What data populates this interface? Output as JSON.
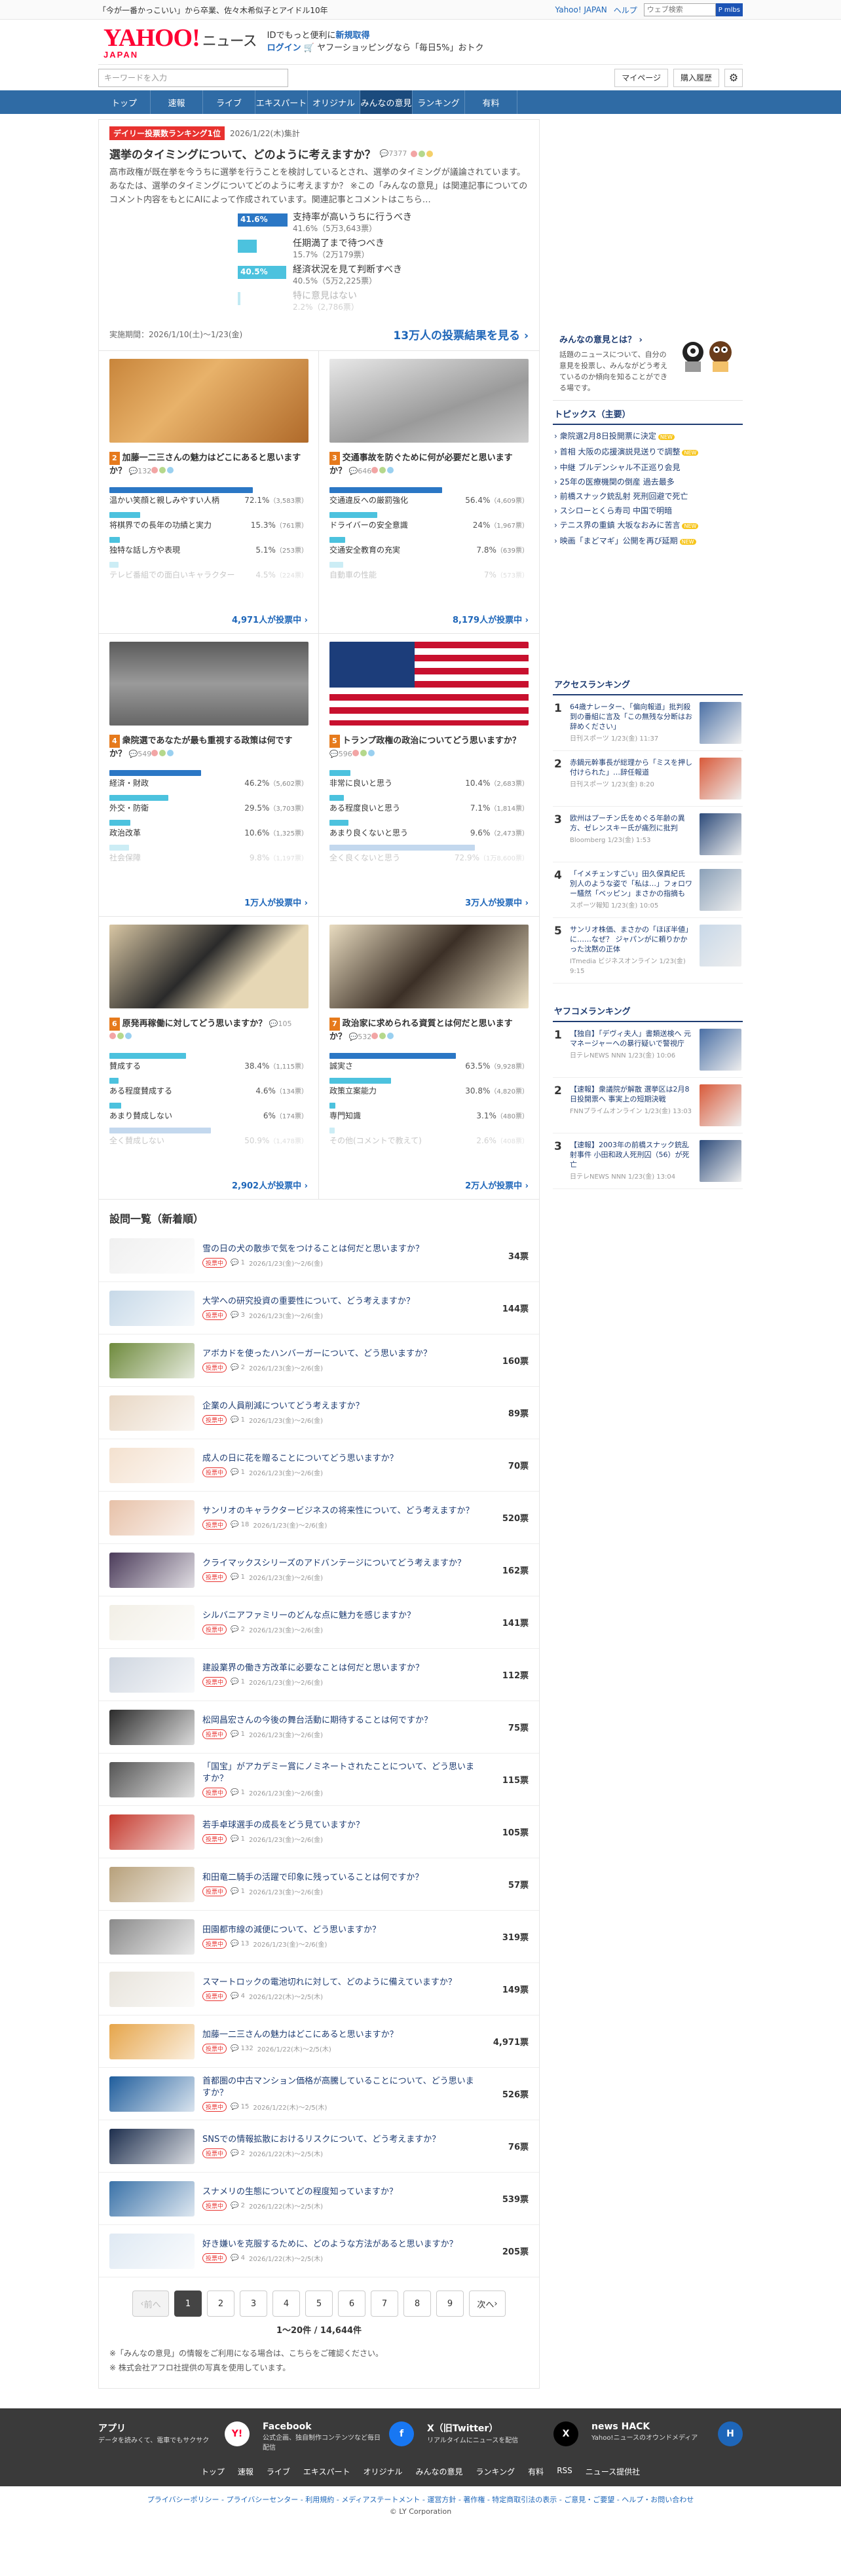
{
  "topbar": {
    "promo": "「今が一番かっこいい」から卒業、佐々木希似子とアイドル10年",
    "links": [
      "Yahoo! JAPAN",
      "ヘルプ"
    ],
    "search_placeholder": "ウェブ検索",
    "search_btn": "P mlbs"
  },
  "header": {
    "logo": "YAHOO!",
    "logo_sub": "JAPAN",
    "logo_news": "ニュース",
    "line1": "IDでもっと便利に",
    "line1_link": "新規取得",
    "line2_login": "ログイン",
    "line2": "ヤフーショッピングなら「毎日5%」おトク"
  },
  "search": {
    "placeholder": "キーワードを入力",
    "mypage": "マイページ",
    "history": "購入履歴"
  },
  "nav": [
    "トップ",
    "速報",
    "ライブ",
    "エキスパート",
    "オリジナル",
    "みんなの意見",
    "ランキング",
    "有料"
  ],
  "featured": {
    "tag": "デイリー投票数ランキング1位",
    "date": "2026/1/22(木)集計",
    "title": "選挙のタイミングについて、どのように考えますか？",
    "comments": "7377",
    "desc": "高市政権が既在挙を今うちに選挙を行うことを検討しているとされ、選挙のタイミングが議論されています。あなたは、選挙のタイミングについてどのように考えますか？ ※この「みんなの意見」は関連記事についてのコメント内容をもとにAIによって作成されています。関連記事とコメントはこちら…",
    "options": [
      {
        "pct": "41.6%",
        "value": 41.6,
        "label": "支持率が高いうちに行うべき",
        "sub": "41.6%（5万3,643票）"
      },
      {
        "pct": "",
        "value": 15.7,
        "label": "任期満了まで待つべき",
        "sub": "15.7%（2万179票）"
      },
      {
        "pct": "40.5%",
        "value": 40.5,
        "label": "経済状況を見て判断すべき",
        "sub": "40.5%（5万2,225票）"
      },
      {
        "pct": "",
        "value": 2.2,
        "label": "特に意見はない",
        "sub": "2.2%（2,786票）"
      }
    ],
    "period": "実施期間：2026/1/10(土)〜1/23(金)",
    "cta": "13万人の投票結果を見る"
  },
  "cards": [
    {
      "num": "2",
      "title": "加藤一二三さんの魅力はどこにあると思いますか？",
      "cm": "132",
      "opts": [
        [
          "温かい笑顔と親しみやすい人柄",
          "72.1%",
          "（3,583票）",
          72.1
        ],
        [
          "将棋界での長年の功績と実力",
          "15.3%",
          "（761票）",
          15.3
        ],
        [
          "独特な話し方や表現",
          "5.1%",
          "（253票）",
          5.1
        ],
        [
          "テレビ番組での面白いキャラクター",
          "4.5%",
          "（224票）",
          4.5
        ]
      ],
      "foot": "4,971人が投票中"
    },
    {
      "num": "3",
      "title": "交通事故を防ぐために何が必要だと思いますか？",
      "cm": "646",
      "opts": [
        [
          "交通違反への厳罰強化",
          "56.4%",
          "（4,609票）",
          56.4
        ],
        [
          "ドライバーの安全意識",
          "24%",
          "（1,967票）",
          24
        ],
        [
          "交通安全教育の充実",
          "7.8%",
          "（639票）",
          7.8
        ],
        [
          "自動車の性能",
          "7%",
          "（573票）",
          7
        ]
      ],
      "foot": "8,179人が投票中"
    },
    {
      "num": "4",
      "title": "衆院選であなたが最も重視する政策は何ですか？",
      "cm": "549",
      "opts": [
        [
          "経済・財政",
          "46.2%",
          "（5,602票）",
          46.2
        ],
        [
          "外交・防衛",
          "29.5%",
          "（3,703票）",
          29.5
        ],
        [
          "政治改革",
          "10.6%",
          "（1,325票）",
          10.6
        ],
        [
          "社会保障",
          "9.8%",
          "（1,197票）",
          9.8
        ]
      ],
      "foot": "1万人が投票中"
    },
    {
      "num": "5",
      "title": "トランプ政権の政治についてどう思いますか？",
      "cm": "596",
      "opts": [
        [
          "非常に良いと思う",
          "10.4%",
          "（2,683票）",
          10.4
        ],
        [
          "ある程度良いと思う",
          "7.1%",
          "（1,814票）",
          7.1
        ],
        [
          "あまり良くないと思う",
          "9.6%",
          "（2,473票）",
          9.6
        ],
        [
          "全く良くないと思う",
          "72.9%",
          "（1万8,600票）",
          72.9
        ]
      ],
      "foot": "3万人が投票中"
    },
    {
      "num": "6",
      "title": "原発再稼働に対してどう思いますか？",
      "cm": "105",
      "opts": [
        [
          "賛成する",
          "38.4%",
          "（1,115票）",
          38.4
        ],
        [
          "ある程度賛成する",
          "4.6%",
          "（134票）",
          4.6
        ],
        [
          "あまり賛成しない",
          "6%",
          "（174票）",
          6
        ],
        [
          "全く賛成しない",
          "50.9%",
          "（1,478票）",
          50.9
        ]
      ],
      "foot": "2,902人が投票中"
    },
    {
      "num": "7",
      "title": "政治家に求められる資質とは何だと思いますか？",
      "cm": "532",
      "opts": [
        [
          "誠実さ",
          "63.5%",
          "（9,928票）",
          63.5
        ],
        [
          "政策立案能力",
          "30.8%",
          "（4,820票）",
          30.8
        ],
        [
          "専門知識",
          "3.1%",
          "（480票）",
          3.1
        ],
        [
          "その他(コメントで教えて)",
          "2.6%",
          "（408票）",
          2.6
        ]
      ],
      "foot": "2万人が投票中"
    }
  ],
  "list": {
    "heading": "設問一覧（新着順）",
    "badge": "投票中",
    "items": [
      {
        "t": "雪の日の犬の散歩で気をつけることは何だと思いますか？",
        "c": "1",
        "d": "2026/1/23(金)〜2/6(金)",
        "v": "34票"
      },
      {
        "t": "大学への研究投資の重要性について、どう考えますか？",
        "c": "3",
        "d": "2026/1/23(金)〜2/6(金)",
        "v": "144票"
      },
      {
        "t": "アボカドを使ったハンバーガーについて、どう思いますか？",
        "c": "2",
        "d": "2026/1/23(金)〜2/6(金)",
        "v": "160票"
      },
      {
        "t": "企業の人員削減についてどう考えますか？",
        "c": "1",
        "d": "2026/1/23(金)〜2/6(金)",
        "v": "89票"
      },
      {
        "t": "成人の日に花を贈ることについてどう思いますか？",
        "c": "1",
        "d": "2026/1/23(金)〜2/6(金)",
        "v": "70票"
      },
      {
        "t": "サンリオのキャラクタービジネスの将来性について、どう考えますか？",
        "c": "18",
        "d": "2026/1/23(金)〜2/6(金)",
        "v": "520票"
      },
      {
        "t": "クライマックスシリーズのアドバンテージについてどう考えますか？",
        "c": "1",
        "d": "2026/1/23(金)〜2/6(金)",
        "v": "162票"
      },
      {
        "t": "シルバニアファミリーのどんな点に魅力を感じますか？",
        "c": "2",
        "d": "2026/1/23(金)〜2/6(金)",
        "v": "141票"
      },
      {
        "t": "建設業界の働き方改革に必要なことは何だと思いますか？",
        "c": "1",
        "d": "2026/1/23(金)〜2/6(金)",
        "v": "112票"
      },
      {
        "t": "松岡昌宏さんの今後の舞台活動に期待することは何ですか？",
        "c": "1",
        "d": "2026/1/23(金)〜2/6(金)",
        "v": "75票"
      },
      {
        "t": "「国宝」がアカデミー賞にノミネートされたことについて、どう思いますか？",
        "c": "1",
        "d": "2026/1/23(金)〜2/6(金)",
        "v": "115票"
      },
      {
        "t": "若手卓球選手の成長をどう見ていますか？",
        "c": "1",
        "d": "2026/1/23(金)〜2/6(金)",
        "v": "105票"
      },
      {
        "t": "和田竜二騎手の活躍で印象に残っていることは何ですか？",
        "c": "1",
        "d": "2026/1/23(金)〜2/6(金)",
        "v": "57票"
      },
      {
        "t": "田園都市線の減便について、どう思いますか？",
        "c": "13",
        "d": "2026/1/23(金)〜2/6(金)",
        "v": "319票"
      },
      {
        "t": "スマートロックの電池切れに対して、どのように備えていますか？",
        "c": "4",
        "d": "2026/1/22(木)〜2/5(木)",
        "v": "149票"
      },
      {
        "t": "加藤一二三さんの魅力はどこにあると思いますか？",
        "c": "132",
        "d": "2026/1/22(木)〜2/5(木)",
        "v": "4,971票"
      },
      {
        "t": "首都圏の中古マンション価格が高騰していることについて、どう思いますか？",
        "c": "15",
        "d": "2026/1/22(木)〜2/5(木)",
        "v": "526票"
      },
      {
        "t": "SNSでの情報拡散におけるリスクについて、どう考えますか？",
        "c": "2",
        "d": "2026/1/22(木)〜2/5(木)",
        "v": "76票"
      },
      {
        "t": "スナメリの生態についてどの程度知っていますか？",
        "c": "2",
        "d": "2026/1/22(木)〜2/5(木)",
        "v": "539票"
      },
      {
        "t": "好き嫌いを克服するために、どのような方法があると思いますか？",
        "c": "4",
        "d": "2026/1/22(木)〜2/5(木)",
        "v": "205票"
      }
    ]
  },
  "pager": {
    "prev": "前へ",
    "pages": [
      "1",
      "2",
      "3",
      "4",
      "5",
      "6",
      "7",
      "8",
      "9"
    ],
    "next": "次へ",
    "count": "1〜20件 / 14,644件"
  },
  "notes": [
    "※「みんなの意見」の情報をご利用になる場合は、こちらをご確認ください。",
    "※ 株式会社アフロ社提供の写真を使用しています。"
  ],
  "right": {
    "op_title": "みんなの意見とは？",
    "op_desc": "話題のニュースについて、自分の意見を投票し、みんながどう考えているのか傾向を知ることができる場です。",
    "topics_h": "トピックス（主要）",
    "topics": [
      "衆院選2月8日投開票に決定",
      "首相 大阪の応援演説見送りで調整",
      "中継 ブルデンシャル不正巡り会見",
      "25年の医療機関の倒産 過去最多",
      "前橋スナック銃乱射 死刑回避で死亡",
      "スシローとくら寿司 中国で明暗",
      "テニス界の重鎮 大坂なおみに苦言",
      "映画「まどマギ」公開を再び延期"
    ],
    "access_h": "アクセスランキング",
    "access": [
      {
        "n": "1",
        "t": "64歳ナレーター、「偏向報道」批判殺到の番組に言及「この無残な分断はお辞めください」",
        "s": "日刊スポーツ 1/23(金) 11:37"
      },
      {
        "n": "2",
        "t": "赤鍋元幹事長が総理から「ミスを押し付けられた」…辞任報道",
        "s": "日刊スポーツ 1/23(金) 8:20"
      },
      {
        "n": "3",
        "t": "欧州はプーチン氏をめぐる年齢の異方、ゼレンスキー氏が痛烈に批判",
        "s": "Bloomberg 1/23(金) 1:53"
      },
      {
        "n": "4",
        "t": "「イメチェンすごい」田久保真紀氏 別人のような姿で「私は…」フォロワー騒然「ベッピン」まさかの指摘も",
        "s": "スポーツ報知 1/23(金) 10:05"
      },
      {
        "n": "5",
        "t": "サンリオ株価、まさかの「ほぼ半値」に……なぜ？ ジャパンがに頼りかかった沈黙の正体",
        "s": "ITmedia ビジネスオンライン 1/23(金) 9:15"
      }
    ],
    "yafuko_h": "ヤフコメランキング",
    "yafuko": [
      {
        "n": "1",
        "t": "【独自】「デヴィ夫人」書類送検へ 元マネージャーへの暴行疑いで警視庁",
        "s": "日テレNEWS NNN 1/23(金) 10:06"
      },
      {
        "n": "2",
        "t": "【速報】衆議院が解散 選挙区は2月8日投開票へ 事実上の短期決戦",
        "s": "FNNプライムオンライン 1/23(金) 13:03"
      },
      {
        "n": "3",
        "t": "【速報】2003年の前橋スナック銃乱射事件 小田和政人死刑囚（56）が死亡",
        "s": "日テレNEWS NNN 1/23(金) 13:04"
      }
    ]
  },
  "footer": {
    "cells": [
      {
        "t": "アプリ",
        "d": "データを読みくて、電車でもサクサク"
      },
      {
        "t": "Facebook",
        "d": "公式企画、独自制作コンテンツなど毎日配信"
      },
      {
        "t": "X（旧Twitter）",
        "d": "リアルタイムにニュースを配信"
      },
      {
        "t": "news HACK",
        "d": "Yahoo!ニュースのオウンドメディア"
      }
    ],
    "nav": [
      "トップ",
      "速報",
      "ライブ",
      "エキスパート",
      "オリジナル",
      "みんなの意見",
      "ランキング",
      "有料",
      "RSS",
      "ニュース提供社"
    ],
    "links": "プライバシーポリシー - プライバシーセンター - 利用規約 - メディアステートメント - 運営方針 - 著作権 - 特定商取引法の表示 - ご意見・ご要望 - ヘルプ・お問い合わせ",
    "copy": "© LY Corporation"
  },
  "colors": {
    "accent": "#1e66b9",
    "nav": "#2f6ba5",
    "bar_top": "#2b77c5",
    "bar": "#4cc2de",
    "tag": "#e8322f"
  }
}
